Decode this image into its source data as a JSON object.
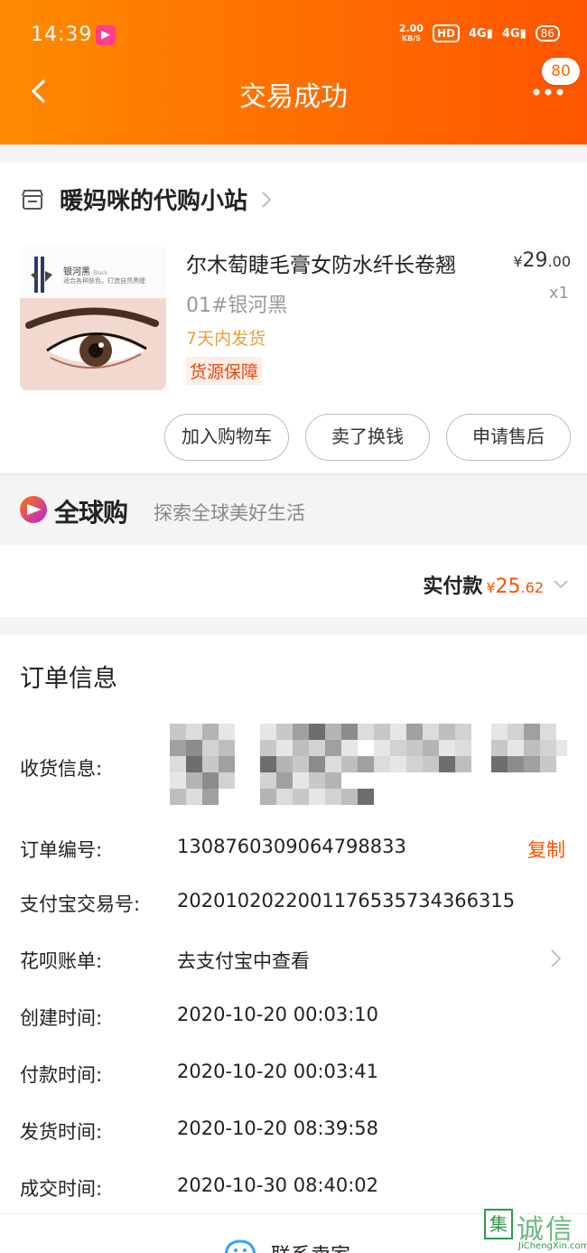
{
  "status_bar": {
    "time": "14:39",
    "net_speed_top": "2.00",
    "net_speed_unit": "KB/S",
    "hd_label": "HD",
    "signal1": "4G",
    "signal2": "4G",
    "battery": "86"
  },
  "header": {
    "title": "交易成功",
    "notification_count": "80",
    "color_start": "#ff8a00",
    "color_end": "#ff5500"
  },
  "shop": {
    "name": "暖妈咪的代购小站"
  },
  "product": {
    "title": "尔木萄睫毛膏女防水纤长卷翘",
    "price_symbol": "¥",
    "price_int": "29",
    "price_dec": ".00",
    "sku": "01#银河黑",
    "quantity": "x1",
    "shipping_note": "7天内发货",
    "guarantee_tag": "货源保障",
    "image_label": "银河黑",
    "image_label_en": "Black",
    "image_sub": "适合各种肤色，打造自然黑睫"
  },
  "actions": {
    "add_to_cart": "加入购物车",
    "sell_for_cash": "卖了换钱",
    "after_sales": "申请售后"
  },
  "global_buy": {
    "name": "全球购",
    "slogan": "探索全球美好生活"
  },
  "payment": {
    "label": "实付款",
    "symbol": "¥",
    "amount_int": "25",
    "amount_dec": ".62",
    "accent": "#ff5000"
  },
  "order_info": {
    "title": "订单信息",
    "shipping_info_label": "收货信息:",
    "order_no_label": "订单编号:",
    "order_no": "1308760309064798833",
    "copy_label": "复制",
    "alipay_no_label": "支付宝交易号:",
    "alipay_no": "2020102022001176535734366315",
    "huabei_label": "花呗账单:",
    "huabei_value": "去支付宝中查看",
    "created_label": "创建时间:",
    "created_value": "2020-10-20 00:03:10",
    "paid_label": "付款时间:",
    "paid_value": "2020-10-20 00:03:41",
    "shipped_label": "发货时间:",
    "shipped_value": "2020-10-20 08:39:58",
    "completed_label": "成交时间:",
    "completed_value": "2020-10-30 08:40:02"
  },
  "contact": {
    "label": "联系卖家"
  },
  "watermark": {
    "box_char": "集",
    "text": "诚信",
    "url": "JiChengXin.com"
  }
}
